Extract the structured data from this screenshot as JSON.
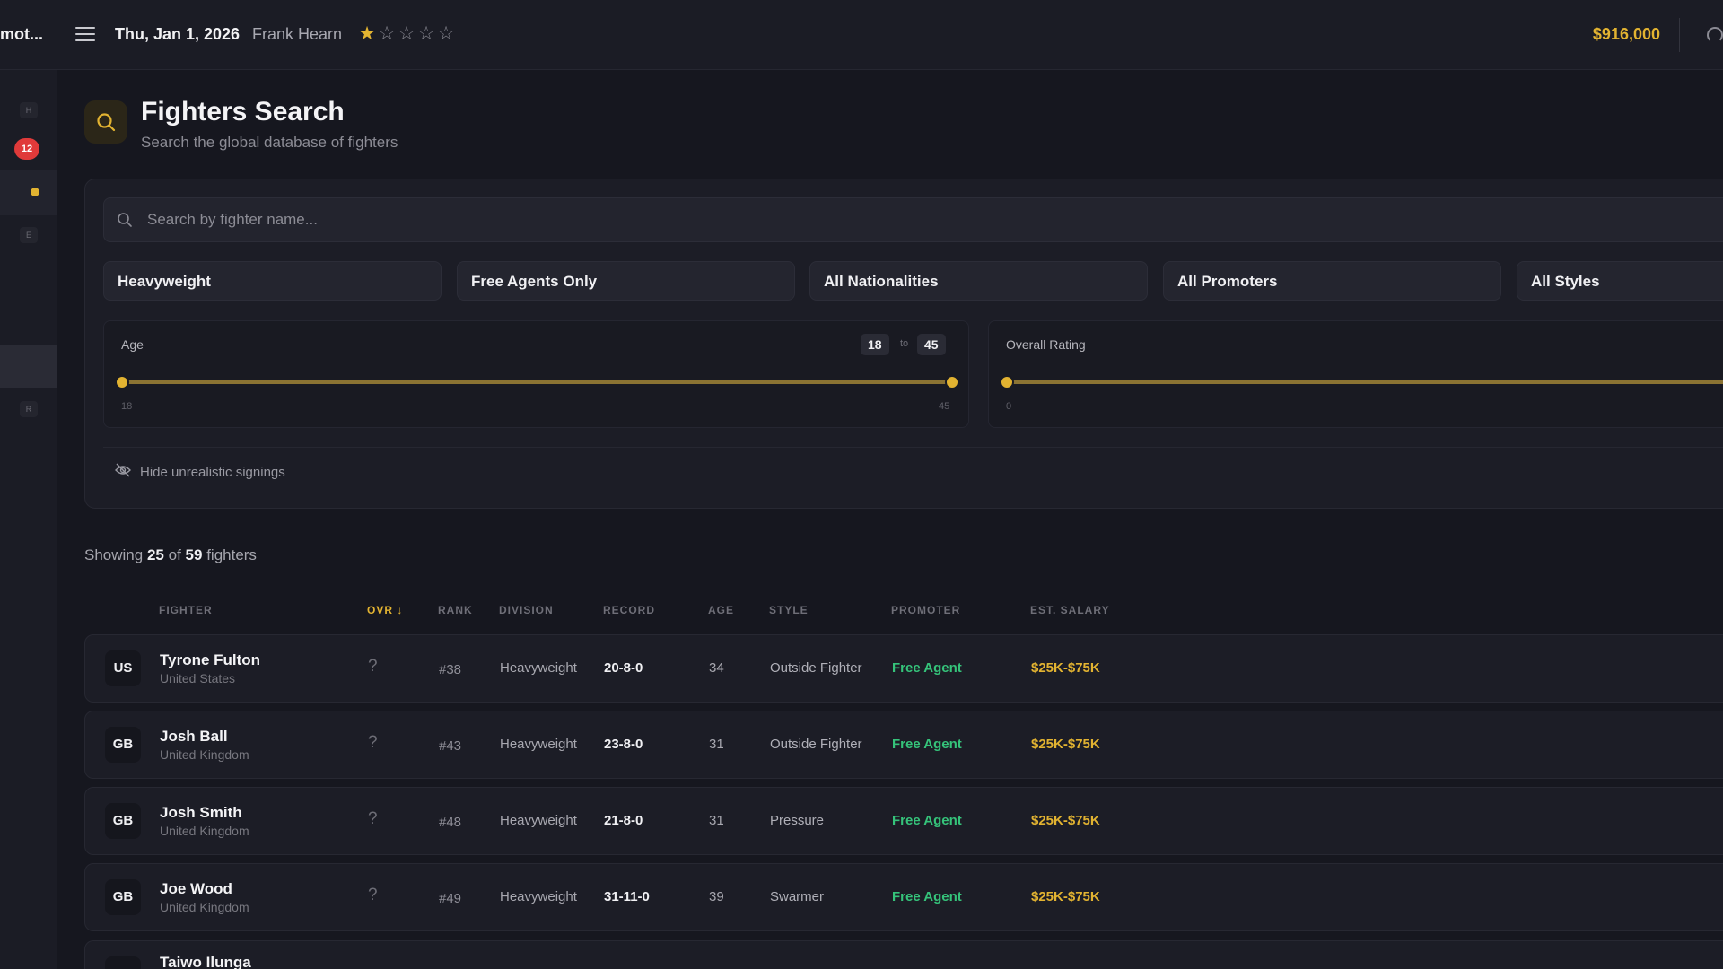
{
  "topbar": {
    "brand": "mot...",
    "date": "Thu, Jan 1, 2026",
    "manager": "Frank Hearn",
    "stars": {
      "filled": 1,
      "total": 5
    },
    "money": "$916,000"
  },
  "sidebar": {
    "keys": [
      "H",
      "E",
      "R"
    ],
    "badge": "12"
  },
  "header": {
    "title": "Fighters Search",
    "subtitle": "Search the global database of fighters"
  },
  "search": {
    "placeholder": "Search by fighter name...",
    "value": ""
  },
  "filters": {
    "weight_class": "Heavyweight",
    "availability": "Free Agents Only",
    "nationality": "All Nationalities",
    "promoter": "All Promoters",
    "style": "All Styles"
  },
  "age_range": {
    "label": "Age",
    "low": "18",
    "to": "to",
    "high": "45",
    "min": "18",
    "max": "45"
  },
  "rating_range": {
    "label": "Overall Rating",
    "min": "0"
  },
  "hide_unrealistic": "Hide unrealistic signings",
  "results": {
    "prefix": "Showing",
    "shown": "25",
    "of": "of",
    "total": "59",
    "suffix": "fighters"
  },
  "table": {
    "headers": {
      "fighter": "FIGHTER",
      "ovr": "OVR ↓",
      "rank": "RANK",
      "division": "DIVISION",
      "record": "RECORD",
      "age": "AGE",
      "style": "STYLE",
      "promoter": "PROMOTER",
      "salary": "EST. SALARY"
    },
    "rows": [
      {
        "flag": "US",
        "name": "Tyrone Fulton",
        "nationality": "United States",
        "ovr": "?",
        "rank": "#38",
        "division": "Heavyweight",
        "record": "20-8-0",
        "age": "34",
        "style": "Outside Fighter",
        "promoter": "Free Agent",
        "salary": "$25K-$75K"
      },
      {
        "flag": "GB",
        "name": "Josh Ball",
        "nationality": "United Kingdom",
        "ovr": "?",
        "rank": "#43",
        "division": "Heavyweight",
        "record": "23-8-0",
        "age": "31",
        "style": "Outside Fighter",
        "promoter": "Free Agent",
        "salary": "$25K-$75K"
      },
      {
        "flag": "GB",
        "name": "Josh Smith",
        "nationality": "United Kingdom",
        "ovr": "?",
        "rank": "#48",
        "division": "Heavyweight",
        "record": "21-8-0",
        "age": "31",
        "style": "Pressure",
        "promoter": "Free Agent",
        "salary": "$25K-$75K"
      },
      {
        "flag": "GB",
        "name": "Joe Wood",
        "nationality": "United Kingdom",
        "ovr": "?",
        "rank": "#49",
        "division": "Heavyweight",
        "record": "31-11-0",
        "age": "39",
        "style": "Swarmer",
        "promoter": "Free Agent",
        "salary": "$25K-$75K"
      },
      {
        "flag": "",
        "name": "Taiwo Ilunga",
        "nationality": "",
        "ovr": "?",
        "rank": "",
        "division": "",
        "record": "",
        "age": "",
        "style": "",
        "promoter": "",
        "salary": ""
      }
    ]
  },
  "colors": {
    "accent": "#e2b331",
    "free_agent": "#35c37a",
    "badge": "#e03a3a",
    "background": "#16171f"
  },
  "icons": [
    "menu-icon",
    "star-icon",
    "gauge-icon",
    "search-icon",
    "eye-off-icon"
  ]
}
